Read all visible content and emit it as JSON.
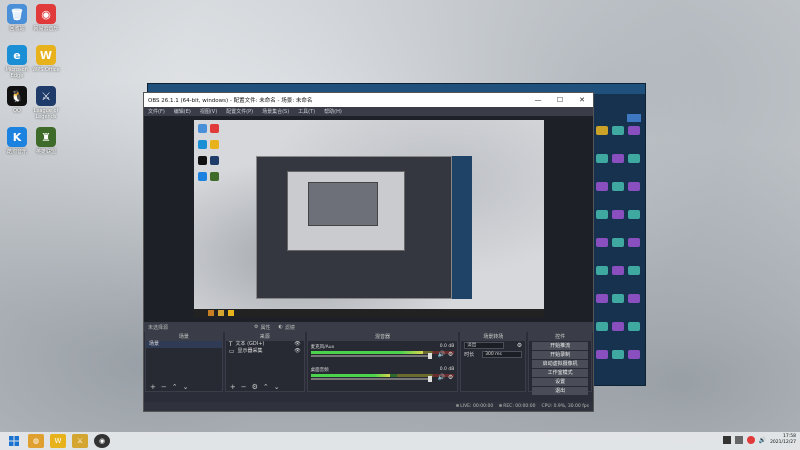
{
  "desktop": {
    "icons": [
      {
        "label": "回收站",
        "color": "#4a90d9",
        "glyph": "🗑"
      },
      {
        "label": "网易云音乐",
        "color": "#e03a3a",
        "glyph": "◉"
      },
      {
        "label": "Microsoft Edge",
        "color": "#1b8fd6",
        "glyph": "e"
      },
      {
        "label": "WPS Office",
        "color": "#e8b21c",
        "glyph": "W"
      },
      {
        "label": "QQ",
        "color": "#111111",
        "glyph": "🐧"
      },
      {
        "label": "League of Legends",
        "color": "#1e3b6a",
        "glyph": "⚔"
      },
      {
        "label": "酷狗音乐",
        "color": "#1b82e0",
        "glyph": "K"
      },
      {
        "label": "英雄联盟",
        "color": "#3f6b2a",
        "glyph": "♜"
      }
    ]
  },
  "obs": {
    "title": "OBS 26.1.1 (64-bit, windows) - 配置文件: 未命名 - 场景: 未命名",
    "window_controls": {
      "minimize": "—",
      "maximize": "☐",
      "close": "✕"
    },
    "menu": [
      "文件(F)",
      "编辑(E)",
      "视图(V)",
      "配置文件(P)",
      "场景集合(S)",
      "工具(T)",
      "帮助(H)"
    ],
    "toolbar": {
      "no_source": "未选择源",
      "properties": "属性",
      "filters": "滤镜"
    },
    "docks": {
      "scenes": {
        "title": "场景",
        "items": [
          "场景"
        ]
      },
      "sources": {
        "title": "来源",
        "items": [
          {
            "name": "文本 (GDI+)",
            "icon": "T"
          },
          {
            "name": "显示器采集",
            "icon": "▭"
          }
        ]
      },
      "mixer": {
        "title": "混音器",
        "channels": [
          {
            "name": "麦克风/Aux",
            "db": "0.0 dB",
            "level": 0.78
          },
          {
            "name": "桌面音频",
            "db": "0.0 dB",
            "level": 0.55
          }
        ]
      },
      "transitions": {
        "title": "场景转场",
        "type": "淡出",
        "duration_label": "时长",
        "duration_value": "300 ms"
      },
      "controls": {
        "title": "控件",
        "buttons": [
          "开始推流",
          "开始录制",
          "启动虚拟摄像机",
          "工作室模式",
          "设置",
          "退出"
        ]
      }
    },
    "status": {
      "live_label": "LIVE:",
      "live_time": "00:00:00",
      "rec_label": "REC:",
      "rec_time": "00:00:00",
      "cpu": "CPU: 0.9%, 30.00 fps"
    }
  },
  "taskbar": {
    "start_icon": "windows-logo",
    "time": "17:58",
    "date": "2021/12/27"
  }
}
